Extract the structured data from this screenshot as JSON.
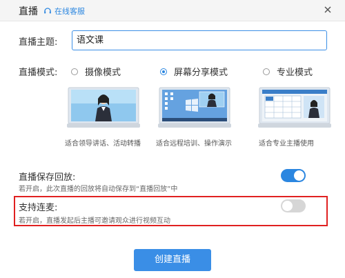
{
  "window": {
    "title": "直播",
    "service_label": "在线客服",
    "close_icon": "close-icon"
  },
  "form": {
    "topic_label": "直播主题:",
    "topic_value": "语文课",
    "mode_label": "直播模式:",
    "modes": [
      {
        "label": "摄像模式",
        "selected": false,
        "caption": "适合领导讲话、活动转播"
      },
      {
        "label": "屏幕分享模式",
        "selected": true,
        "caption": "适合远程培训、操作演示"
      },
      {
        "label": "专业模式",
        "selected": false,
        "caption": "适合专业主播使用"
      }
    ]
  },
  "settings": {
    "replay": {
      "label": "直播保存回放:",
      "description": "若开启，此次直播的回放将自动保存到“直播回放”中",
      "enabled": true
    },
    "co_host": {
      "label": "支持连麦:",
      "description": "若开启，直播发起后主播可邀请观众进行视频互动",
      "enabled": false
    }
  },
  "actions": {
    "create_label": "创建直播"
  },
  "colors": {
    "accent": "#2b86e0",
    "highlight_border": "#e02020",
    "toggle_off": "#d6d6d6"
  }
}
